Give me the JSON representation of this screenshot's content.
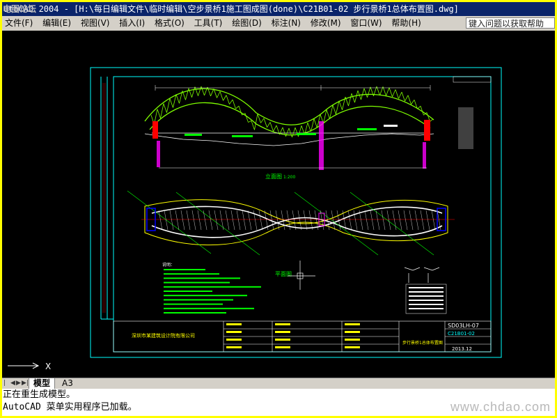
{
  "window": {
    "title_prefix": "utoCAD 2004 - ",
    "title_path": "[H:\\每日编辑文件\\临时编辑\\空步景桥1施工图成图(done)\\C21B01-02 步行景桥1总体布置图.dwg]"
  },
  "watermarks": {
    "top_left": "电图论坛",
    "bottom_right": "www.chdao.com"
  },
  "menu": [
    {
      "label": "文件(F)"
    },
    {
      "label": "编辑(E)"
    },
    {
      "label": "视图(V)"
    },
    {
      "label": "插入(I)"
    },
    {
      "label": "格式(O)"
    },
    {
      "label": "工具(T)"
    },
    {
      "label": "绘图(D)"
    },
    {
      "label": "标注(N)"
    },
    {
      "label": "修改(M)"
    },
    {
      "label": "窗口(W)"
    },
    {
      "label": "帮助(H)"
    }
  ],
  "help_search": {
    "placeholder": "键入问题以获取帮助"
  },
  "tabs": {
    "model": "模型",
    "layout": "A3"
  },
  "ucs": {
    "x_label": "X"
  },
  "drawing": {
    "titleblock": {
      "company": "深圳市某建筑设计院有限公司",
      "drawing_title": "步行景桥1总体布置图",
      "drawing_number": "C21B01-02",
      "sheet_code": "SD03LH-07",
      "date": "2013.12"
    },
    "elevation_label": "立面图",
    "elevation_scale": "1:200",
    "plan_label": "平面图",
    "notes_title": "说明："
  },
  "colors": {
    "background": "#000000",
    "frame": "#00ffff",
    "truss": "#7fff00",
    "deck": "#ffffff",
    "annotation": "#00ff00",
    "accent_red": "#ff0000",
    "accent_magenta": "#ff00ff",
    "accent_yellow": "#ffff00",
    "accent_blue": "#0000ff"
  },
  "command_line": {
    "line1": "正在重生成模型。",
    "line2": "AutoCAD 菜单实用程序已加载。"
  }
}
